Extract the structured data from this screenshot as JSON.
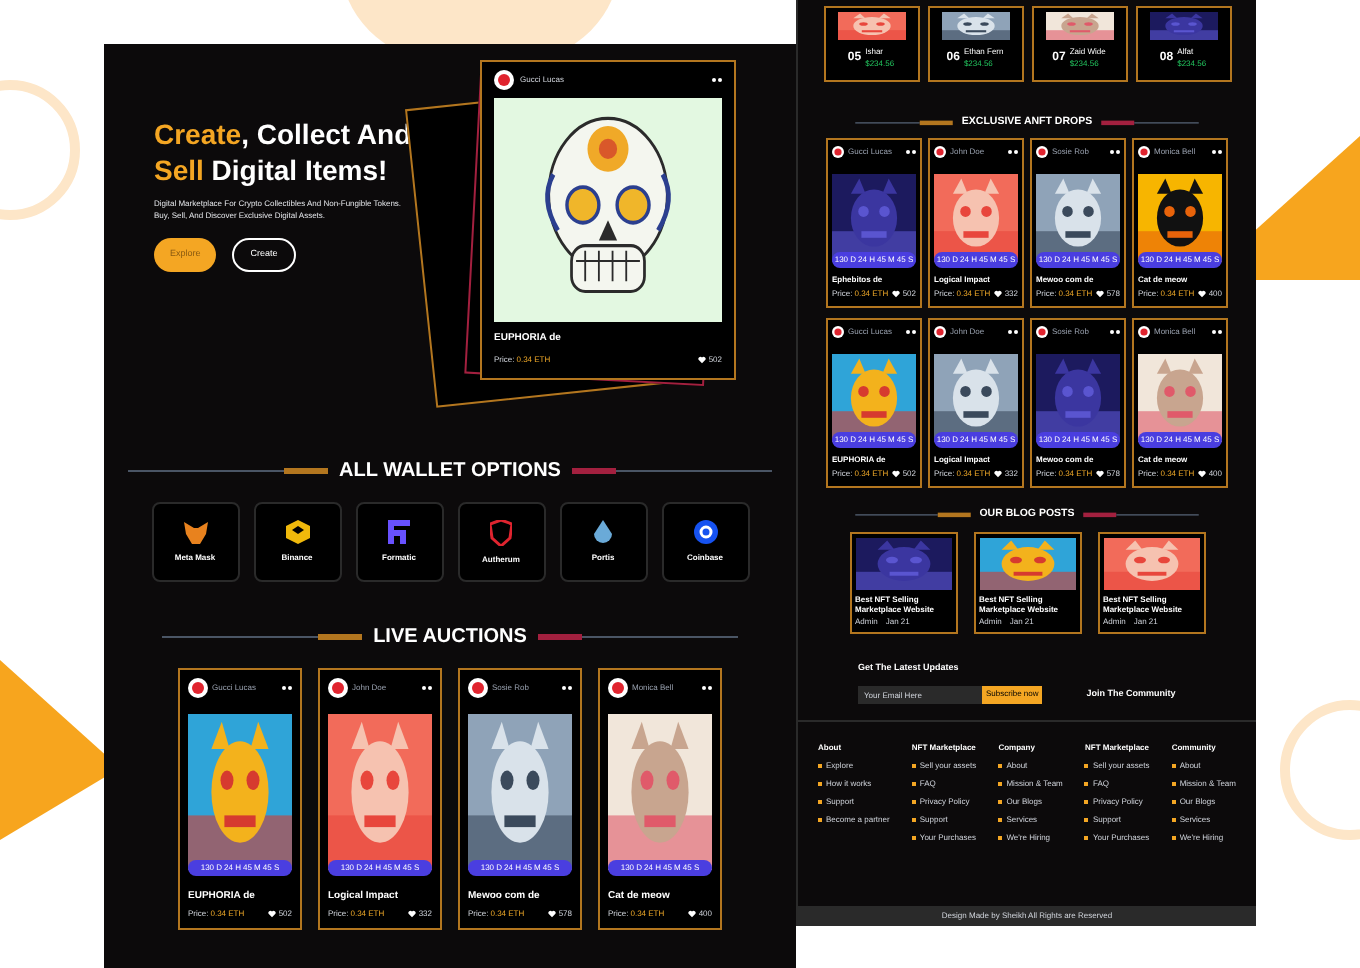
{
  "hero": {
    "title_accent_1": "Create",
    "title_rest_1": ", Collect And",
    "title_accent_2": "Sell",
    "title_rest_2": "Digital Items!",
    "description": "Digital Marketplace For Crypto Collectibles And Non-Fungible Tokens. Buy, Sell, And Discover Exclusive Digital Assets.",
    "buttons": [
      {
        "label": "Explore",
        "kind": "primary"
      },
      {
        "label": "Create",
        "kind": "outline"
      }
    ],
    "featured": {
      "owner": "Gucci Lucas",
      "title": "EUPHORIA de",
      "price_label": "Price:",
      "price": "0.34 ETH",
      "likes": "502"
    }
  },
  "wallets": {
    "heading": "ALL WALLET OPTIONS",
    "items": [
      {
        "name": "Meta Mask",
        "kind": "fox"
      },
      {
        "name": "Binance",
        "kind": "binance"
      },
      {
        "name": "Formatic",
        "kind": "formatic"
      },
      {
        "name": "Autherum",
        "kind": "shield"
      },
      {
        "name": "Portis",
        "kind": "drop"
      },
      {
        "name": "Coinbase",
        "kind": "coin"
      }
    ]
  },
  "auctions": {
    "heading": "LIVE  AUCTIONS",
    "cards": [
      {
        "owner": "Gucci Lucas",
        "title": "EUPHORIA de",
        "price_label": "Price:",
        "price": "0.34 ETH",
        "likes": "502",
        "timer": [
          "130 D",
          "24 H",
          "45 M",
          "45 S"
        ]
      },
      {
        "owner": "John Doe",
        "title": "Logical Impact",
        "price_label": "Price:",
        "price": "0.34 ETH",
        "likes": "332",
        "timer": [
          "130 D",
          "24 H",
          "45 M",
          "45 S"
        ]
      },
      {
        "owner": "Sosie Rob",
        "title": "Mewoo com de",
        "price_label": "Price:",
        "price": "0.34 ETH",
        "likes": "578",
        "timer": [
          "130 D",
          "24 H",
          "45 M",
          "45 S"
        ]
      },
      {
        "owner": "Monica Bell",
        "title": "Cat de meow",
        "price_label": "Price:",
        "price": "0.34 ETH",
        "likes": "400",
        "timer": [
          "130 D",
          "24 H",
          "45 M",
          "45 S"
        ]
      }
    ]
  },
  "sellers": [
    {
      "rank": "05",
      "name": "Ishar",
      "amount": "$234.56"
    },
    {
      "rank": "06",
      "name": "Ethan Fern",
      "amount": "$234.56"
    },
    {
      "rank": "07",
      "name": "Zaid Wide",
      "amount": "$234.56"
    },
    {
      "rank": "08",
      "name": "Alfat",
      "amount": "$234.56"
    }
  ],
  "drops": {
    "heading": "EXCLUSIVE ANFT DROPS",
    "cards": [
      {
        "owner": "Gucci Lucas",
        "title": "Ephebitos de",
        "price_label": "Price:",
        "price": "0.34 ETH",
        "likes": "502",
        "timer": [
          "130 D",
          "24 H",
          "45 M",
          "45 S"
        ]
      },
      {
        "owner": "John Doe",
        "title": "Logical Impact",
        "price_label": "Price:",
        "price": "0.34 ETH",
        "likes": "332",
        "timer": [
          "130 D",
          "24 H",
          "45 M",
          "45 S"
        ]
      },
      {
        "owner": "Sosie Rob",
        "title": "Mewoo com de",
        "price_label": "Price:",
        "price": "0.34 ETH",
        "likes": "578",
        "timer": [
          "130 D",
          "24 H",
          "45 M",
          "45 S"
        ]
      },
      {
        "owner": "Monica Bell",
        "title": "Cat de meow",
        "price_label": "Price:",
        "price": "0.34 ETH",
        "likes": "400",
        "timer": [
          "130 D",
          "24 H",
          "45 M",
          "45 S"
        ]
      },
      {
        "owner": "Gucci Lucas",
        "title": "EUPHORIA de",
        "price_label": "Price:",
        "price": "0.34 ETH",
        "likes": "502",
        "timer": [
          "130 D",
          "24 H",
          "45 M",
          "45 S"
        ]
      },
      {
        "owner": "John Doe",
        "title": "Logical Impact",
        "price_label": "Price:",
        "price": "0.34 ETH",
        "likes": "332",
        "timer": [
          "130 D",
          "24 H",
          "45 M",
          "45 S"
        ]
      },
      {
        "owner": "Sosie Rob",
        "title": "Mewoo com de",
        "price_label": "Price:",
        "price": "0.34 ETH",
        "likes": "578",
        "timer": [
          "130 D",
          "24 H",
          "45 M",
          "45 S"
        ]
      },
      {
        "owner": "Monica Bell",
        "title": "Cat de meow",
        "price_label": "Price:",
        "price": "0.34 ETH",
        "likes": "400",
        "timer": [
          "130 D",
          "24 H",
          "45 M",
          "45 S"
        ]
      }
    ]
  },
  "blog": {
    "heading": "OUR BLOG POSTS",
    "posts": [
      {
        "title": "Best NFT Selling Marketplace Website",
        "author": "Admin",
        "date": "Jan 21"
      },
      {
        "title": "Best NFT Selling Marketplace Website",
        "author": "Admin",
        "date": "Jan 21"
      },
      {
        "title": "Best NFT Selling Marketplace Website",
        "author": "Admin",
        "date": "Jan 21"
      }
    ]
  },
  "newsletter": {
    "heading": "Get The Latest Updates",
    "placeholder": "Your Email Here",
    "button": "Subscribe now",
    "community": "Join The Community"
  },
  "footer": {
    "columns": [
      {
        "title": "About",
        "links": [
          "Explore",
          "How it works",
          "Support",
          "Become a partner"
        ]
      },
      {
        "title": "NFT Marketplace",
        "links": [
          "Sell your assets",
          "FAQ",
          "Privacy Policy",
          "Support",
          "Your Purchases"
        ]
      },
      {
        "title": "Company",
        "links": [
          "About",
          "Mission & Team",
          "Our Blogs",
          "Services",
          "We're Hiring"
        ]
      },
      {
        "title": "NFT Marketplace",
        "links": [
          "Sell your assets",
          "FAQ",
          "Privacy Policy",
          "Support",
          "Your Purchases"
        ]
      },
      {
        "title": "Community",
        "links": [
          "About",
          "Mission & Team",
          "Our Blogs",
          "Services",
          "We're Hiring"
        ]
      }
    ],
    "copyright": "Design Made by Sheikh All Rights are Reserved"
  }
}
